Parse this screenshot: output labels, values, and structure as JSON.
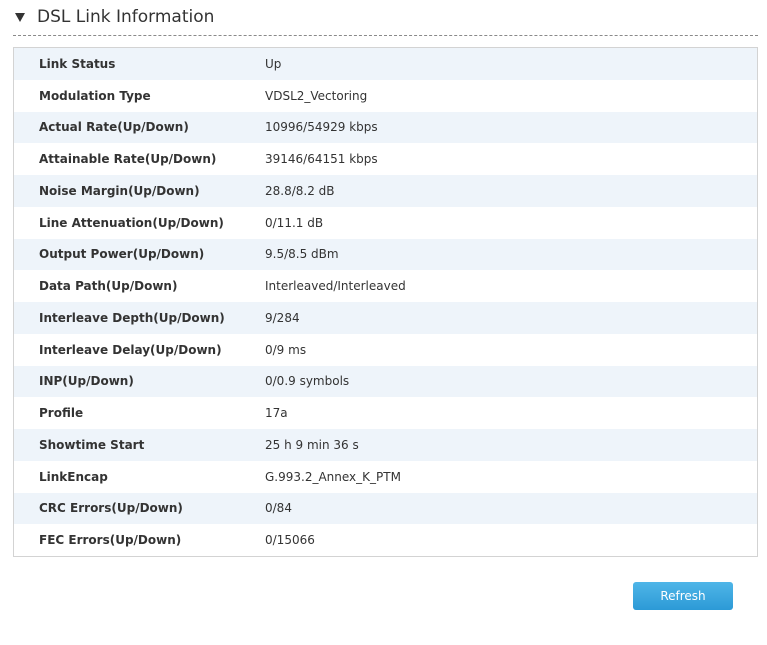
{
  "section": {
    "title": "DSL Link Information"
  },
  "rows": [
    {
      "label": "Link Status",
      "value": "Up"
    },
    {
      "label": "Modulation Type",
      "value": "VDSL2_Vectoring"
    },
    {
      "label": "Actual Rate(Up/Down)",
      "value": "10996/54929 kbps"
    },
    {
      "label": "Attainable Rate(Up/Down)",
      "value": "39146/64151 kbps"
    },
    {
      "label": "Noise Margin(Up/Down)",
      "value": "28.8/8.2 dB"
    },
    {
      "label": "Line Attenuation(Up/Down)",
      "value": "0/11.1 dB"
    },
    {
      "label": "Output Power(Up/Down)",
      "value": "9.5/8.5 dBm"
    },
    {
      "label": "Data Path(Up/Down)",
      "value": "Interleaved/Interleaved"
    },
    {
      "label": "Interleave Depth(Up/Down)",
      "value": "9/284"
    },
    {
      "label": "Interleave Delay(Up/Down)",
      "value": "0/9 ms"
    },
    {
      "label": "INP(Up/Down)",
      "value": "0/0.9 symbols"
    },
    {
      "label": "Profile",
      "value": "17a"
    },
    {
      "label": "Showtime Start",
      "value": "25 h 9 min 36 s"
    },
    {
      "label": "LinkEncap",
      "value": "G.993.2_Annex_K_PTM"
    },
    {
      "label": "CRC Errors(Up/Down)",
      "value": "0/84"
    },
    {
      "label": "FEC Errors(Up/Down)",
      "value": "0/15066"
    }
  ],
  "actions": {
    "refresh_label": "Refresh"
  },
  "colors": {
    "row_stripe": "#eef4fa",
    "button_accent": "#2c9ad6"
  }
}
